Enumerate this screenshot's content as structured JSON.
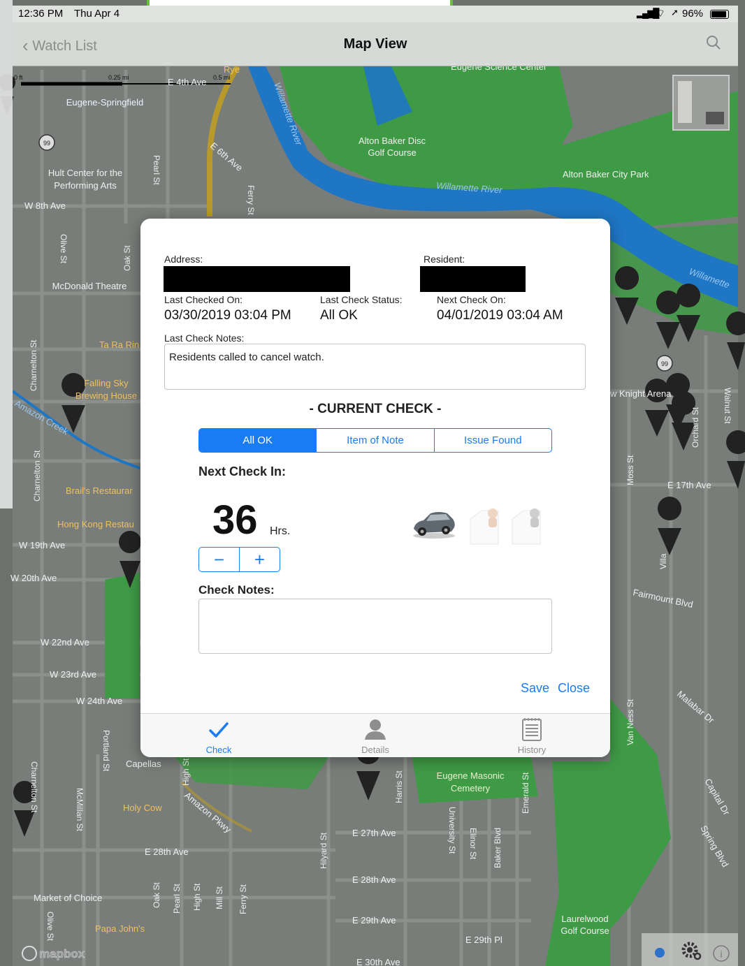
{
  "status_bar": {
    "time": "12:36 PM",
    "date": "Thu Apr 4",
    "battery": "96%"
  },
  "nav": {
    "back_label": "Watch List",
    "title": "Map View"
  },
  "map": {
    "labels": {
      "eugene_springfield": "Eugene-Springfield",
      "hult": "Hult Center for the",
      "hult2": "Performing Arts",
      "w8th": "W 8th Ave",
      "mcdonald": "McDonald Theatre",
      "tarari": "Ta Ra Rin",
      "falling1": "Falling Sky",
      "falling2": "Brewing House",
      "amazon_creek": "Amazon Creek",
      "brails": "Brail's Restaurar",
      "hongkong": "Hong Kong Restau",
      "w19th": "W 19th Ave",
      "w20th": "W 20th Ave",
      "w22nd": "W 22nd Ave",
      "w23rd": "W 23rd Ave",
      "w24th": "W 24th Ave",
      "capellas": "Capellas",
      "holycow": "Holy Cow",
      "e28th_w": "E 28th Ave",
      "market": "Market of Choice",
      "papajohns": "Papa John's",
      "alton_disc1": "Alton Baker Disc",
      "alton_disc2": "Golf Course",
      "willamette1": "Willamette River",
      "willamette2": "Willamette River",
      "willamette3": "Willamette",
      "alton_park": "Alton Baker City Park",
      "science": "Eugene Science Center",
      "knight": "w Knight Arena",
      "e17th": "E 17th Ave",
      "fairmount": "Fairmount Blvd",
      "malabar": "Malabar Dr",
      "masonic1": "Eugene Masonic",
      "masonic2": "Cemetery",
      "e27th": "E 27th Ave",
      "e28th": "E 28th Ave",
      "e29th": "E 29th Ave",
      "e29th_pl": "E 29th Pl",
      "e30th": "E 30th Ave",
      "laurel1": "Laurelwood",
      "laurel2": "Golf Course",
      "e6th": "E 6th Ave",
      "e4th": "E 4th Ave",
      "amazon_pkwy": "Amazon Pkwy",
      "capital": "Capital Dr",
      "spring": "Spring Blvd",
      "rye": "Rye",
      "hwy99": "99",
      "scale_0": "0 ft",
      "scale_025": "0.25 mi",
      "scale_05": "0.5 mi",
      "mapbox": "mapbox"
    },
    "streets_vertical": {
      "pearl": "Pearl St",
      "ferry": "Ferry St",
      "olive": "Olive St",
      "oak": "Oak St",
      "charnelton": "Charnelton St",
      "charnelton2": "Charnelton St",
      "charnelton3": "Charnelton St",
      "portland": "Portland St",
      "mcmillan": "McMillan St",
      "highst": "High St",
      "hilyard": "Hilyard St",
      "harris": "Harris St",
      "university": "University St",
      "elinor": "Elinor St",
      "baker": "Baker Blvd",
      "emerald": "Emerald St",
      "vanness": "Van Ness St",
      "moss": "Moss St",
      "orchard": "Orchard St",
      "walnut": "Walnut St",
      "villa": "Villa",
      "oak2": "Oak St",
      "pearl2": "Pearl St",
      "high2": "High St",
      "mill": "Mill St",
      "ferry2": "Ferry St",
      "olive2": "Olive St"
    }
  },
  "modal": {
    "address_label": "Address:",
    "resident_label": "Resident:",
    "last_checked_label": "Last Checked On:",
    "last_checked_value": "03/30/2019 03:04 PM",
    "last_status_label": "Last Check Status:",
    "last_status_value": "All OK",
    "next_check_label": "Next Check On:",
    "next_check_value": "04/01/2019 03:04 AM",
    "last_notes_label": "Last Check Notes:",
    "last_notes_value": "Residents called to cancel watch.",
    "current_check_heading": "- CURRENT CHECK -",
    "segments": [
      "All OK",
      "Item of Note",
      "Issue Found"
    ],
    "selected_segment": "All OK",
    "next_check_in_label": "Next Check In:",
    "hours_value": "36",
    "hours_unit": "Hrs.",
    "stepper_minus": "−",
    "stepper_plus": "+",
    "check_notes_label": "Check Notes:",
    "check_notes_value": "",
    "save_label": "Save",
    "close_label": "Close",
    "tabs": [
      {
        "label": "Check",
        "icon": "checkmark-icon",
        "active": true
      },
      {
        "label": "Details",
        "icon": "person-icon",
        "active": false
      },
      {
        "label": "History",
        "icon": "notepad-icon",
        "active": false
      }
    ]
  },
  "colors": {
    "accent": "#1a7cf5",
    "map_water": "#1f76c4",
    "map_park": "#3f9a46",
    "map_road": "#b79a2b"
  }
}
